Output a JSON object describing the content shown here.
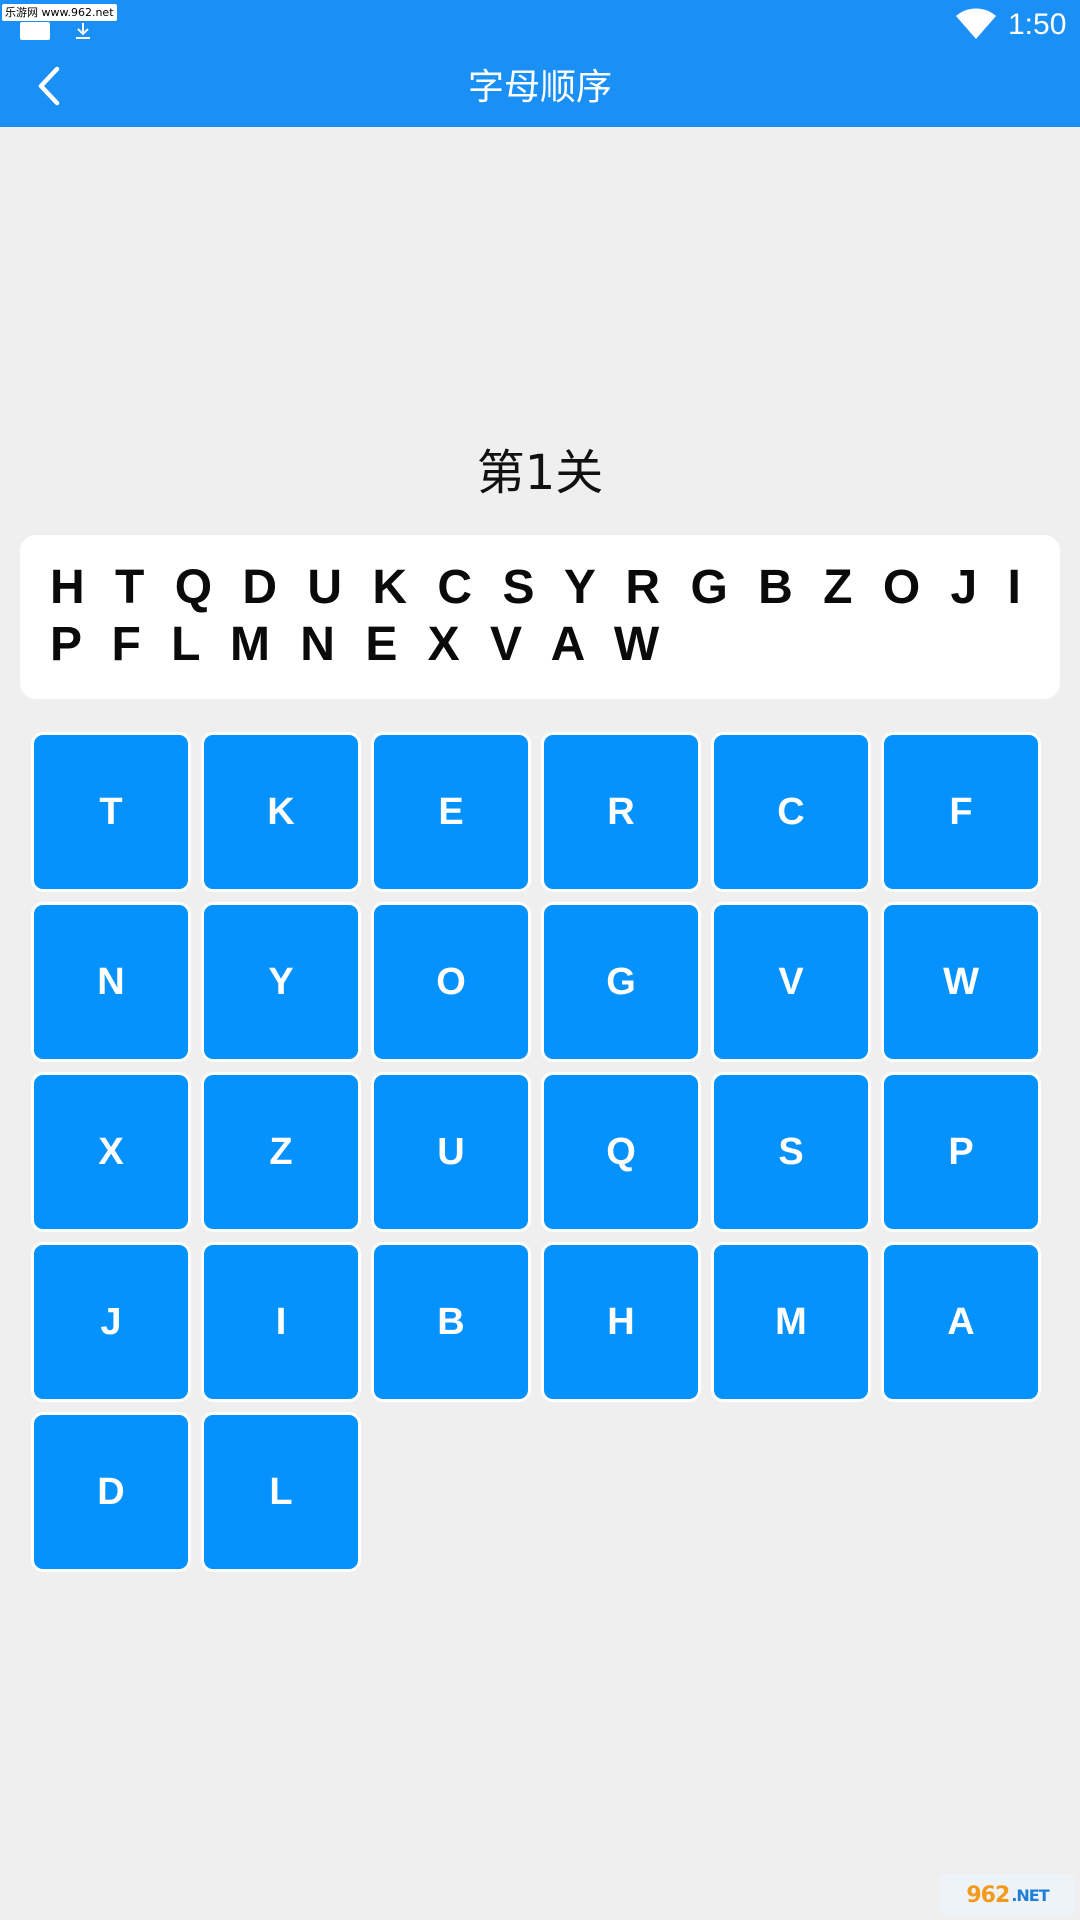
{
  "status_bar": {
    "watermark": "乐游网 www.962.net",
    "time": "1:50"
  },
  "header": {
    "back_icon": "chevron-left-icon",
    "title": "字母顺序"
  },
  "level": {
    "label": "第1关"
  },
  "sequence": {
    "letters": [
      "H",
      "T",
      "Q",
      "D",
      "U",
      "K",
      "C",
      "S",
      "Y",
      "R",
      "G",
      "B",
      "Z",
      "O",
      "J",
      "I",
      "P",
      "F",
      "L",
      "M",
      "N",
      "E",
      "X",
      "V",
      "A",
      "W"
    ]
  },
  "keypad": {
    "keys": [
      "T",
      "K",
      "E",
      "R",
      "C",
      "F",
      "N",
      "Y",
      "O",
      "G",
      "V",
      "W",
      "X",
      "Z",
      "U",
      "Q",
      "S",
      "P",
      "J",
      "I",
      "B",
      "H",
      "M",
      "A",
      "D",
      "L"
    ]
  },
  "footer": {
    "watermark_main": "962",
    "watermark_suffix": ".NET"
  },
  "colors": {
    "appbar": "#1a8ff5",
    "key": "#0592fc",
    "background": "#efefef"
  }
}
